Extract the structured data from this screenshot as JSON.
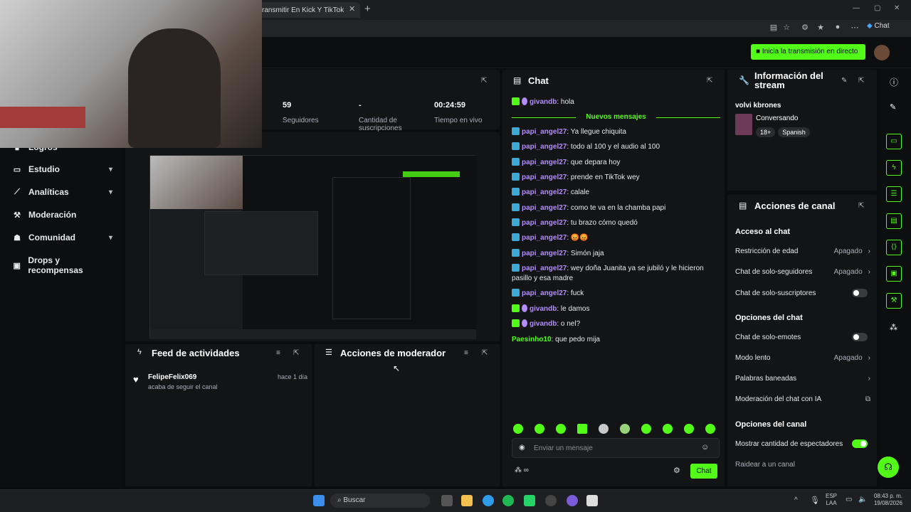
{
  "browser": {
    "tab_title": "ransmitir En Kick Y TikTok",
    "chat_pill": "Chat"
  },
  "topbar": {
    "go_live_label": "Inicia la transmisión en directo"
  },
  "sidebar": {
    "items": [
      {
        "label": "Logros",
        "has_chevron": false
      },
      {
        "label": "Estudio",
        "has_chevron": true
      },
      {
        "label": "Analíticas",
        "has_chevron": true
      },
      {
        "label": "Moderación",
        "has_chevron": false
      },
      {
        "label": "Comunidad",
        "has_chevron": true
      },
      {
        "label": "Drops y recompensas",
        "has_chevron": false
      }
    ]
  },
  "stats": [
    {
      "value": "59",
      "label": "Seguidores"
    },
    {
      "value": "-",
      "label": "Cantidad de suscripciones"
    },
    {
      "value": "00:24:59",
      "label": "Tiempo en vivo"
    }
  ],
  "activity_feed": {
    "title": "Feed de actividades",
    "items": [
      {
        "user": "FelipeFelix069",
        "time": "hace 1 día",
        "desc": "acaba de seguir el canal"
      }
    ]
  },
  "mod_actions": {
    "title": "Acciones de moderador"
  },
  "chat": {
    "title": "Chat",
    "new_messages_label": "Nuevos mensajes",
    "messages": [
      {
        "user": "givandb",
        "text": ": hola",
        "badge": "green-purple"
      },
      {
        "user": "papi_angel27",
        "text": ": Ya llegue chiquita",
        "badge": "blue"
      },
      {
        "user": "papi_angel27",
        "text": ": todo al 100 y el audio al 100",
        "badge": "blue"
      },
      {
        "user": "papi_angel27",
        "text": ": que depara hoy",
        "badge": "blue"
      },
      {
        "user": "papi_angel27",
        "text": ": prende en TikTok wey",
        "badge": "blue"
      },
      {
        "user": "papi_angel27",
        "text": ": calale",
        "badge": "blue"
      },
      {
        "user": "papi_angel27",
        "text": ": como te va en la chamba papi",
        "badge": "blue"
      },
      {
        "user": "papi_angel27",
        "text": ": tu brazo cómo quedó",
        "badge": "blue"
      },
      {
        "user": "papi_angel27",
        "text": ": 😡😡",
        "badge": "blue"
      },
      {
        "user": "papi_angel27",
        "text": ": Simón jaja",
        "badge": "blue"
      },
      {
        "user": "papi_angel27",
        "text": ": wey doña Juanita ya se jubiló y le hicieron pasillo y esa madre",
        "badge": "blue"
      },
      {
        "user": "papi_angel27",
        "text": ": fuck",
        "badge": "blue"
      },
      {
        "user": "givandb",
        "text": ": le damos",
        "badge": "green-purple"
      },
      {
        "user": "givandb",
        "text": ": o nel?",
        "badge": "green-purple"
      },
      {
        "user": "Paesinho10",
        "text": ": que pedo mija",
        "badge": "none"
      }
    ],
    "input_placeholder": "Enviar un mensaje",
    "send_label": "Chat"
  },
  "stream_info": {
    "title": "Información del stream",
    "stream_title": "volvi kbrones",
    "category": "Conversando",
    "tags": [
      "18+",
      "Spanish"
    ]
  },
  "channel_actions": {
    "title": "Acciones de canal",
    "sections": {
      "chat_access": "Acceso al chat",
      "chat_options": "Opciones del chat",
      "channel_options": "Opciones del canal"
    },
    "rows": {
      "age_restriction": {
        "label": "Restricción de edad",
        "value": "Apagado"
      },
      "followers_only": {
        "label": "Chat de solo-seguidores",
        "value": "Apagado"
      },
      "subs_only": {
        "label": "Chat de solo-suscriptores"
      },
      "emotes_only": {
        "label": "Chat de solo-emotes"
      },
      "slow_mode": {
        "label": "Modo lento",
        "value": "Apagado"
      },
      "banned_words": {
        "label": "Palabras baneadas"
      },
      "ai_moderation": {
        "label": "Moderación del chat con IA"
      },
      "show_viewers": {
        "label": "Mostrar cantidad de espectadores"
      },
      "raid": {
        "label": "Raidear a un canal"
      }
    }
  },
  "taskbar": {
    "search_label": "Buscar",
    "lang_top": "ESP",
    "lang_bottom": "LAA",
    "time": "08:43 p. m.",
    "date": "19/08/2026"
  },
  "colors": {
    "accent": "#53fc18",
    "panel": "#131416",
    "background": "#0b0c0e",
    "username_purple": "#b48cff",
    "badge_blue": "#3fa9d6"
  }
}
